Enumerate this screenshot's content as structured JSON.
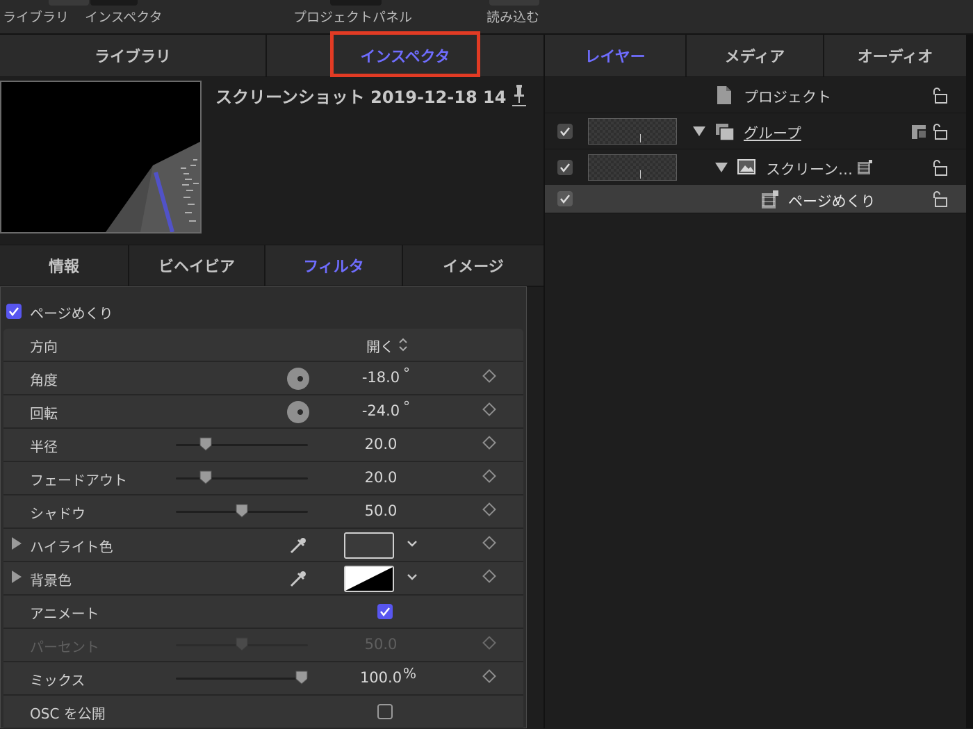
{
  "toolbar": {
    "library_label": "ライブラリ",
    "inspector_label": "インスペクタ",
    "project_panel_label": "プロジェクトパネル",
    "import_label": "読み込む"
  },
  "left_tabs": {
    "library": "ライブラリ",
    "inspector": "インスペクタ",
    "active": "インスペクタ"
  },
  "right_tabs": {
    "layers": "レイヤー",
    "media": "メディア",
    "audio": "オーディオ",
    "active": "レイヤー"
  },
  "clip": {
    "title": "スクリーンショット 2019-12-18 14"
  },
  "sub_tabs": {
    "info": "情報",
    "behavior": "ビヘイビア",
    "filter": "フィルタ",
    "image": "イメージ",
    "active": "フィルタ"
  },
  "filter": {
    "name": "ページめくり",
    "enabled": true,
    "params": {
      "direction": {
        "label": "方向",
        "value": "開く"
      },
      "angle": {
        "label": "角度",
        "value": "-18.0",
        "unit": "°"
      },
      "rotation": {
        "label": "回転",
        "value": "-24.0",
        "unit": "°"
      },
      "radius": {
        "label": "半径",
        "value": "20.0",
        "slider": 0.2
      },
      "fadeout": {
        "label": "フェードアウト",
        "value": "20.0",
        "slider": 0.2
      },
      "shadow": {
        "label": "シャドウ",
        "value": "50.0",
        "slider": 0.5
      },
      "highlight_color": {
        "label": "ハイライト色",
        "color": "#3a3a3a"
      },
      "background_color": {
        "label": "背景色",
        "color_a": "#ffffff",
        "color_b": "#000000"
      },
      "animate": {
        "label": "アニメート",
        "checked": true
      },
      "percent": {
        "label": "パーセント",
        "value": "50.0",
        "slider": 0.5,
        "disabled": true
      },
      "mix": {
        "label": "ミックス",
        "value": "100.0",
        "unit": "%",
        "slider": 1.0
      },
      "publish_osc": {
        "label": "OSC を公開",
        "checked": false
      }
    }
  },
  "layers": {
    "project": "プロジェクト",
    "group": "グループ",
    "clip": "スクリーン…",
    "filter": "ページめくり"
  },
  "colors": {
    "accent": "#6f6dff",
    "checkbox": "#5856f0",
    "highlight_box": "#e23b24"
  }
}
